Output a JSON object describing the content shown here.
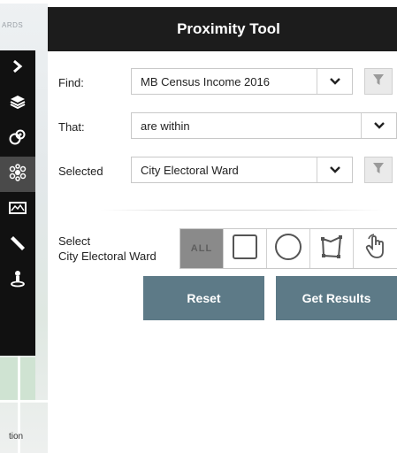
{
  "map": {
    "label_top": "ARDS",
    "label_bottom": "tion"
  },
  "sidebar": {
    "items": [
      {
        "icon": "chevron-right-icon"
      },
      {
        "icon": "layers-icon"
      },
      {
        "icon": "map-theme-icon"
      },
      {
        "icon": "proximity-icon",
        "active": true
      },
      {
        "icon": "basemap-icon"
      },
      {
        "icon": "measure-ruler-icon"
      },
      {
        "icon": "locate-person-icon"
      }
    ]
  },
  "panel": {
    "title": "Proximity Tool",
    "find_label": "Find:",
    "find_value": "MB Census Income 2016",
    "that_label": "That:",
    "that_value": "are within",
    "selected_label": "Selected",
    "selected_value": "City Electoral Ward",
    "select_label_line1": "Select",
    "select_label_line2": "City Electoral Ward",
    "tool_all_label": "ALL",
    "reset_label": "Reset",
    "get_results_label": "Get Results"
  }
}
